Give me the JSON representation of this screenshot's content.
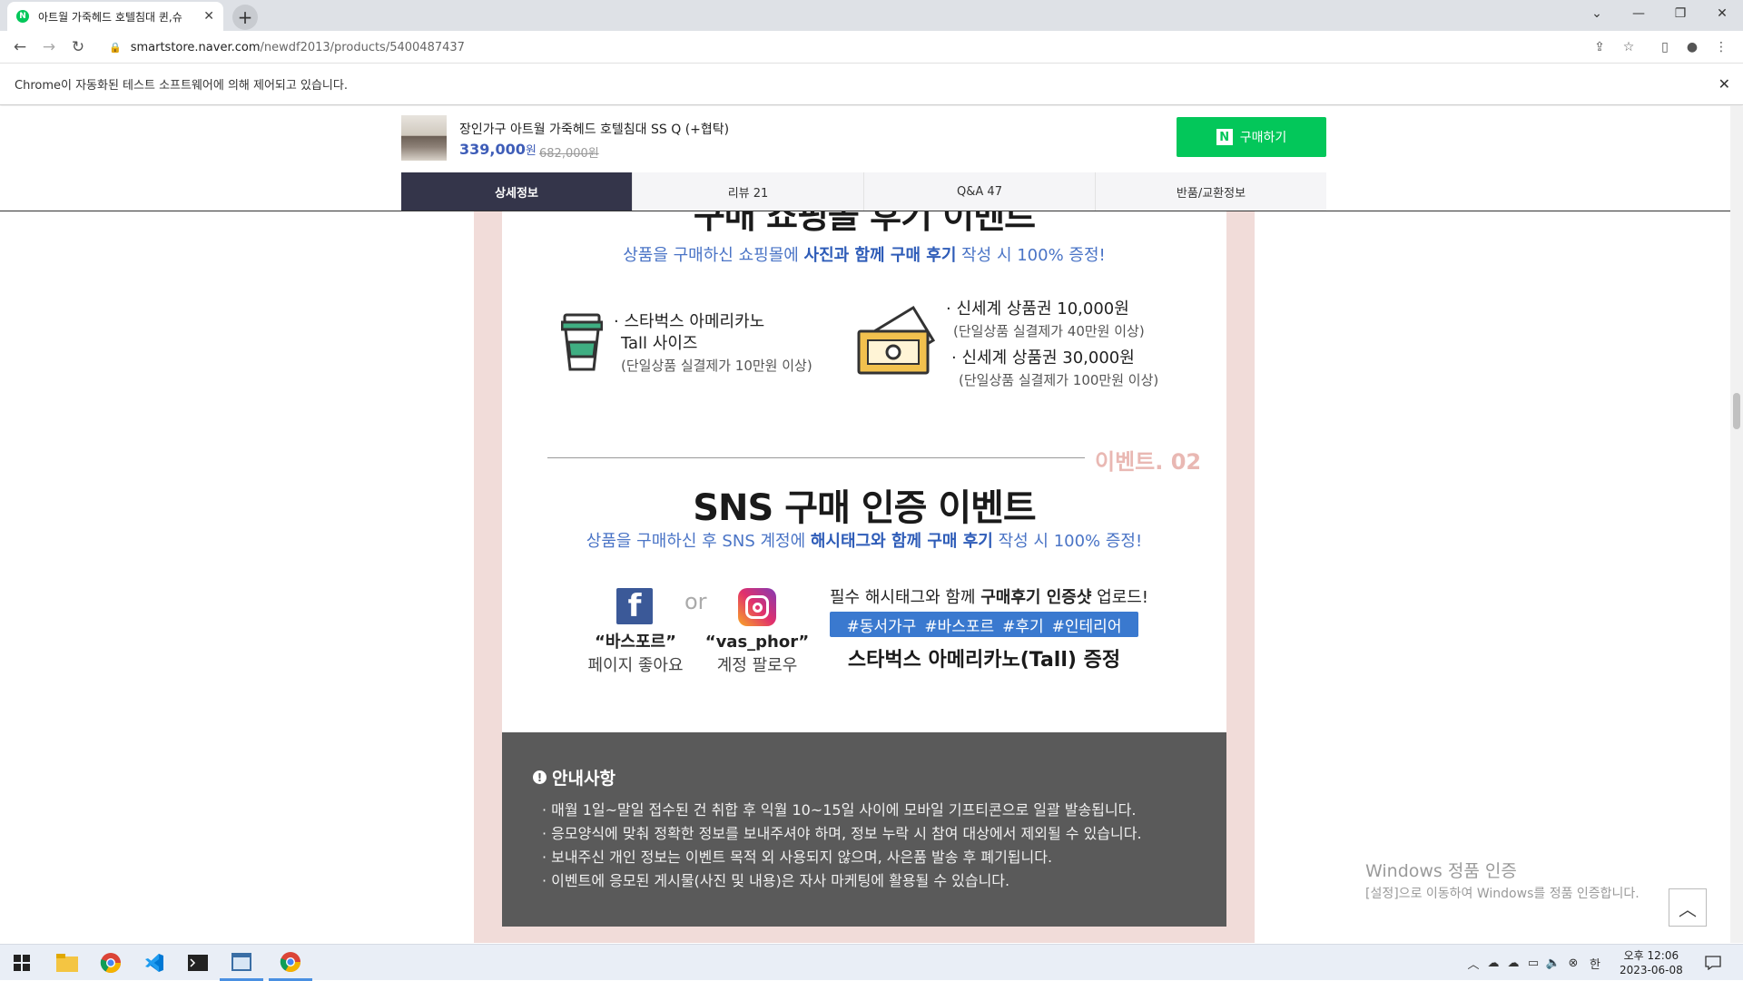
{
  "browser": {
    "tab_title": "아트월 가죽헤드 호텔침대 퀸,슈",
    "url_domain": "smartstore.naver.com",
    "url_path": "/newdf2013/products/5400487437",
    "infobar_text": "Chrome이 자동화된 테스트 소프트웨어에 의해 제어되고 있습니다."
  },
  "product": {
    "name": "장인가구 아트월 가죽헤드 호텔침대 SS Q (+협탁)",
    "price": "339,000",
    "price_unit": "원",
    "original_price": "682,000원",
    "buy_label": "구매하기",
    "buy_logo": "N"
  },
  "tabs": [
    {
      "label": "상세정보"
    },
    {
      "label": "리뷰 21"
    },
    {
      "label": "Q&A 47"
    },
    {
      "label": "반품/교환정보"
    }
  ],
  "event1": {
    "heading": "구매 쇼핑몰 후기 이벤트",
    "sub_pre": "상품을 구매하신 쇼핑몰에 ",
    "sub_bold": "사진과 함께 구매 후기",
    "sub_post": " 작성 시 100% 증정!",
    "reward_a_line1": "· 스타벅스 아메리카노",
    "reward_a_line2": "Tall 사이즈",
    "reward_a_cond": "(단일상품 실결제가 10만원 이상)",
    "reward_b1": "· 신세계 상품권 10,000원",
    "reward_b1_cond": "(단일상품 실결제가 40만원 이상)",
    "reward_b2": "· 신세계 상품권 30,000원",
    "reward_b2_cond": "(단일상품 실결제가 100만원 이상)"
  },
  "event2": {
    "tag": "이벤트. 02",
    "heading": "SNS 구매 인증 이벤트",
    "sub_pre": "상품을 구매하신 후 SNS 계정에 ",
    "sub_bold": "해시태그와 함께 구매 후기",
    "sub_post": " 작성 시 100% 증정!",
    "or_text": "or",
    "fb_name": "“바스포르”",
    "fb_action": "페이지 좋아요",
    "ig_name": "“vas_phor”",
    "ig_action": "계정 팔로우",
    "hash_intro_pre": "필수 해시태그와 함께 ",
    "hash_intro_bold": "구매후기 인증샷",
    "hash_intro_post": " 업로드!",
    "hashtags": [
      "#동서가구",
      "#바스포르",
      "#후기",
      "#인테리어"
    ],
    "gift": "스타벅스 아메리카노(Tall) 증정"
  },
  "notice": {
    "title": "안내사항",
    "items": [
      "매월 1일~말일 접수된 건 취합 후 익월 10~15일 사이에 모바일 기프티콘으로 일괄 발송됩니다.",
      "응모양식에 맞춰 정확한 정보를 보내주셔야 하며, 정보 누락 시 참여 대상에서 제외될 수 있습니다.",
      "보내주신 개인 정보는 이벤트 목적 외 사용되지 않으며, 사은품 발송 후 폐기됩니다.",
      "이벤트에 응모된 게시물(사진 및 내용)은 자사 마케팅에 활용될 수 있습니다."
    ]
  },
  "watermark": {
    "line1": "Windows 정품 인증",
    "line2": "[설정]으로 이동하여 Windows를 정품 인증합니다."
  },
  "taskbar": {
    "time": "오후 12:06",
    "date": "2023-06-08",
    "ime": "한"
  },
  "colors": {
    "naver_green": "#03c75a",
    "price_blue": "#3e5db8",
    "active_tab": "#34354a",
    "event_bg": "#f1dcd9",
    "hashtag_blue": "#3a79cf",
    "notice_bg": "#5a5a5a"
  }
}
